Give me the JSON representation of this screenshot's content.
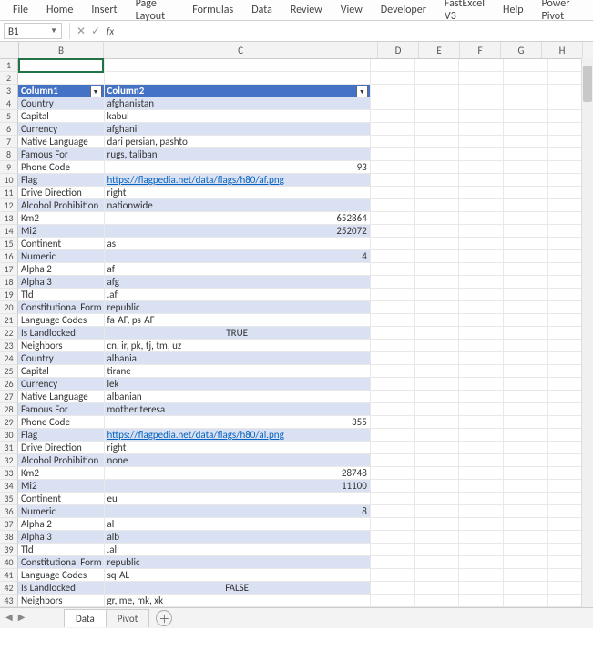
{
  "ribbon": {
    "tabs": [
      "File",
      "Home",
      "Insert",
      "Page Layout",
      "Formulas",
      "Data",
      "Review",
      "View",
      "Developer",
      "FastExcel V3",
      "Help",
      "Power Pivot"
    ]
  },
  "namebox": {
    "value": "B1"
  },
  "formula": {
    "value": ""
  },
  "columns": [
    "B",
    "C",
    "D",
    "E",
    "F",
    "G",
    "H"
  ],
  "tableHeaders": {
    "col1": "Column1",
    "col2": "Column2"
  },
  "rows": [
    {
      "n": 1,
      "b": "",
      "c": "",
      "band": null,
      "header": false
    },
    {
      "n": 2,
      "b": "",
      "c": "",
      "band": null,
      "header": false
    },
    {
      "n": 3,
      "b": "Column1",
      "c": "Column2",
      "band": null,
      "header": true
    },
    {
      "n": 4,
      "b": "Country",
      "c": "afghanistan",
      "band": 0
    },
    {
      "n": 5,
      "b": "Capital",
      "c": "kabul",
      "band": 1
    },
    {
      "n": 6,
      "b": "Currency",
      "c": "afghani",
      "band": 0
    },
    {
      "n": 7,
      "b": "Native Language",
      "c": "dari persian, pashto",
      "band": 1
    },
    {
      "n": 8,
      "b": "Famous For",
      "c": "rugs, taliban",
      "band": 0
    },
    {
      "n": 9,
      "b": "Phone Code",
      "c": "93",
      "band": 1,
      "numeric": true
    },
    {
      "n": 10,
      "b": "Flag",
      "c": "https://flagpedia.net/data/flags/h80/af.png",
      "band": 0,
      "link": true
    },
    {
      "n": 11,
      "b": "Drive Direction",
      "c": "right",
      "band": 1
    },
    {
      "n": 12,
      "b": "Alcohol Prohibition",
      "c": "nationwide",
      "band": 0
    },
    {
      "n": 13,
      "b": "Km2",
      "c": "652864",
      "band": 1,
      "numeric": true
    },
    {
      "n": 14,
      "b": "Mi2",
      "c": "252072",
      "band": 0,
      "numeric": true
    },
    {
      "n": 15,
      "b": "Continent",
      "c": "as",
      "band": 1
    },
    {
      "n": 16,
      "b": "Numeric",
      "c": "4",
      "band": 0,
      "numeric": true
    },
    {
      "n": 17,
      "b": "Alpha 2",
      "c": "af",
      "band": 1
    },
    {
      "n": 18,
      "b": "Alpha 3",
      "c": "afg",
      "band": 0
    },
    {
      "n": 19,
      "b": "Tld",
      "c": ".af",
      "band": 1
    },
    {
      "n": 20,
      "b": "Constitutional Form",
      "c": "republic",
      "band": 0
    },
    {
      "n": 21,
      "b": "Language Codes",
      "c": "fa-AF, ps-AF",
      "band": 1
    },
    {
      "n": 22,
      "b": "Is Landlocked",
      "c": "TRUE",
      "band": 0,
      "center": true
    },
    {
      "n": 23,
      "b": "Neighbors",
      "c": "cn, ir, pk, tj, tm, uz",
      "band": 1
    },
    {
      "n": 24,
      "b": "Country",
      "c": "albania",
      "band": 0
    },
    {
      "n": 25,
      "b": "Capital",
      "c": "tirane",
      "band": 1
    },
    {
      "n": 26,
      "b": "Currency",
      "c": "lek",
      "band": 0
    },
    {
      "n": 27,
      "b": "Native Language",
      "c": "albanian",
      "band": 1
    },
    {
      "n": 28,
      "b": "Famous For",
      "c": "mother teresa",
      "band": 0
    },
    {
      "n": 29,
      "b": "Phone Code",
      "c": "355",
      "band": 1,
      "numeric": true
    },
    {
      "n": 30,
      "b": "Flag",
      "c": "https://flagpedia.net/data/flags/h80/al.png",
      "band": 0,
      "link": true
    },
    {
      "n": 31,
      "b": "Drive Direction",
      "c": "right",
      "band": 1
    },
    {
      "n": 32,
      "b": "Alcohol Prohibition",
      "c": "none",
      "band": 0
    },
    {
      "n": 33,
      "b": "Km2",
      "c": "28748",
      "band": 1,
      "numeric": true
    },
    {
      "n": 34,
      "b": "Mi2",
      "c": "11100",
      "band": 0,
      "numeric": true
    },
    {
      "n": 35,
      "b": "Continent",
      "c": "eu",
      "band": 1
    },
    {
      "n": 36,
      "b": "Numeric",
      "c": "8",
      "band": 0,
      "numeric": true
    },
    {
      "n": 37,
      "b": "Alpha 2",
      "c": "al",
      "band": 1
    },
    {
      "n": 38,
      "b": "Alpha 3",
      "c": "alb",
      "band": 0
    },
    {
      "n": 39,
      "b": "Tld",
      "c": ".al",
      "band": 1
    },
    {
      "n": 40,
      "b": "Constitutional Form",
      "c": "republic",
      "band": 0
    },
    {
      "n": 41,
      "b": "Language Codes",
      "c": "sq-AL",
      "band": 1
    },
    {
      "n": 42,
      "b": "Is Landlocked",
      "c": "FALSE",
      "band": 0,
      "center": true
    },
    {
      "n": 43,
      "b": "Neighbors",
      "c": "gr, me, mk, xk",
      "band": 1
    }
  ],
  "sheets": {
    "active": "Data",
    "other": "Pivot"
  }
}
